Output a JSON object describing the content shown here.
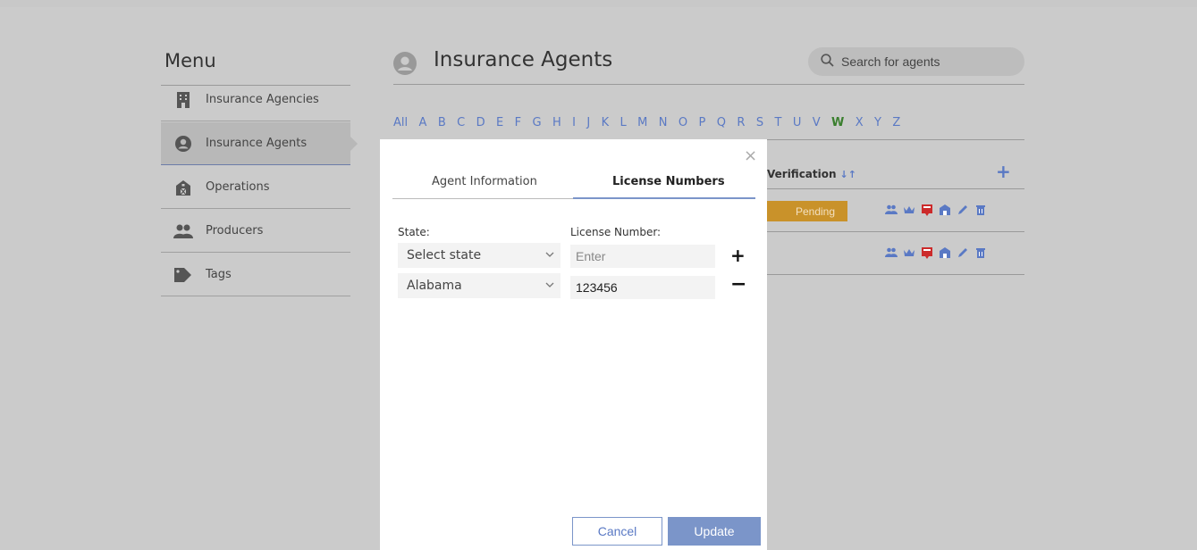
{
  "menu": {
    "title": "Menu",
    "items": [
      {
        "label": "Insurance Agencies",
        "icon": "building-icon"
      },
      {
        "label": "Insurance Agents",
        "icon": "user-circle-icon",
        "active": true
      },
      {
        "label": "Operations",
        "icon": "barn-icon"
      },
      {
        "label": "Producers",
        "icon": "users-icon"
      },
      {
        "label": "Tags",
        "icon": "tag-icon"
      }
    ]
  },
  "header": {
    "title": "Insurance Agents",
    "search_placeholder": "Search for agents"
  },
  "alphabet": {
    "letters": [
      "All",
      "A",
      "B",
      "C",
      "D",
      "E",
      "F",
      "G",
      "H",
      "I",
      "J",
      "K",
      "L",
      "M",
      "N",
      "O",
      "P",
      "Q",
      "R",
      "S",
      "T",
      "U",
      "V",
      "W",
      "X",
      "Y",
      "Z"
    ],
    "selected": "W"
  },
  "table": {
    "verification_header": "Verification",
    "rows": [
      {
        "status": "Pending"
      },
      {
        "status": ""
      }
    ]
  },
  "modal": {
    "close": "×",
    "tabs": [
      "Agent Information",
      "License Numbers"
    ],
    "active_tab": "License Numbers",
    "state_label": "State:",
    "license_label": "License Number:",
    "rows": [
      {
        "state": "Select state",
        "license": "",
        "license_placeholder": "Enter",
        "action": "+"
      },
      {
        "state": "Alabama",
        "license": "123456",
        "license_placeholder": "",
        "action": "−"
      }
    ],
    "cancel_label": "Cancel",
    "update_label": "Update"
  },
  "colors": {
    "accent": "#7b95c9",
    "link": "#5a79c4",
    "selected_letter": "#3a7f2e",
    "pending": "#c9922a",
    "danger_icon": "#cc2b2b"
  }
}
